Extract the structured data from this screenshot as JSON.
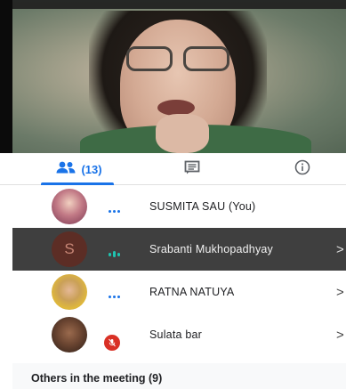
{
  "tabs": {
    "people_count": "(13)",
    "active": "people",
    "accent_color": "#1a73e8",
    "icons": [
      "people-icon",
      "chat-icon",
      "info-icon"
    ]
  },
  "participants": [
    {
      "name": "SUSMITA SAU (You)",
      "status": "speaking-dots",
      "has_chevron": false
    },
    {
      "name": "Srabanti Mukhopadhyay",
      "avatar_letter": "S",
      "status": "audio-bars",
      "has_chevron": true,
      "chevron": ">"
    },
    {
      "name": "RATNA NATUYA",
      "status": "speaking-dots",
      "has_chevron": true,
      "chevron": ">"
    },
    {
      "name": "Sulata bar",
      "status": "muted",
      "has_chevron": true,
      "chevron": ">"
    }
  ],
  "others": {
    "label": "Others in the meeting (9)"
  }
}
